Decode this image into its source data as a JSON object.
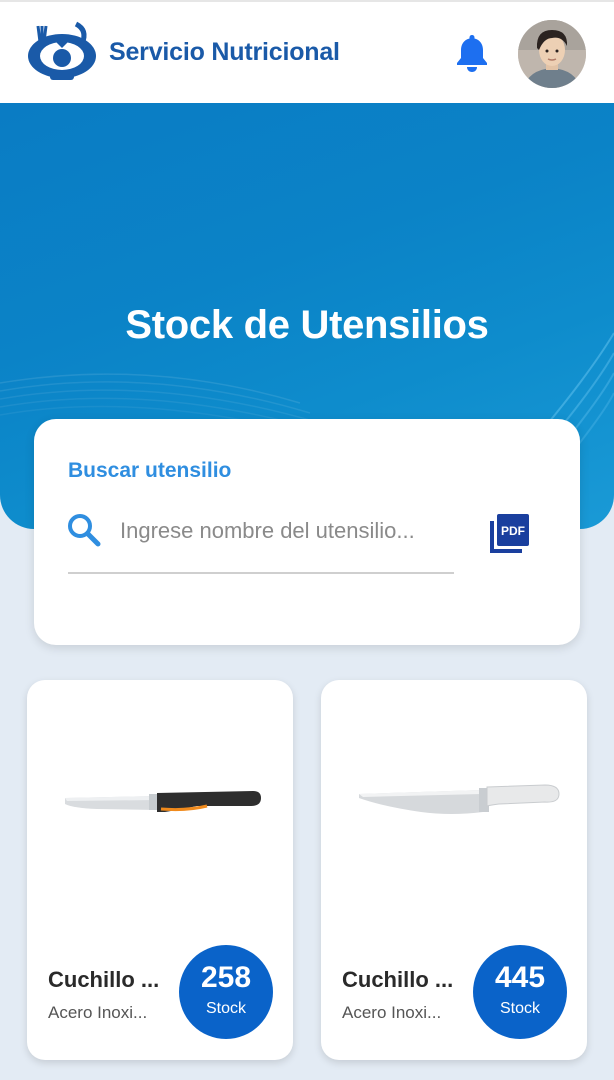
{
  "header": {
    "app_title": "Servicio Nutricional",
    "logo_icon": "nutrition-logo-icon",
    "notification_icon": "bell-icon",
    "avatar_icon": "user-avatar"
  },
  "hero": {
    "title": "Stock de Utensilios"
  },
  "search": {
    "label": "Buscar utensilio",
    "placeholder": "Ingrese nombre del utensilio...",
    "value": "",
    "search_icon": "search-icon",
    "pdf_icon": "pdf-export-icon",
    "pdf_text": "PDF"
  },
  "products": [
    {
      "name": "Cuchillo ...",
      "material": "Acero Inoxi...",
      "stock": "258",
      "stock_label": "Stock",
      "image_icon": "paring-knife-image"
    },
    {
      "name": "Cuchillo ...",
      "material": "Acero Inoxi...",
      "stock": "445",
      "stock_label": "Stock",
      "image_icon": "chef-knife-image"
    }
  ],
  "colors": {
    "brand_blue": "#1a5aa8",
    "hero_blue": "#0b83c7",
    "accent_blue": "#2f8ee0",
    "badge_blue": "#0a63c9",
    "background": "#e3ebf4"
  }
}
